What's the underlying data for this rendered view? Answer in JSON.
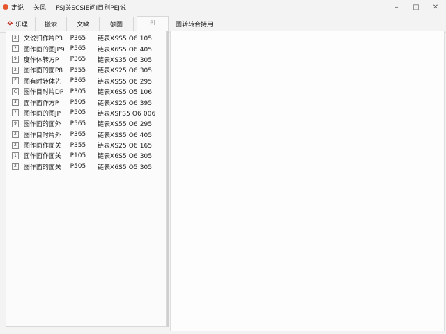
{
  "titlebar": {
    "segments": [
      "定说",
      "关风",
      "FSJ关SCSIE问I目别PEJ说"
    ],
    "minimize": "–",
    "maximize": "□",
    "close": "✕"
  },
  "toolbar": {
    "buttons": [
      {
        "label": "乐理",
        "icon": "✥"
      },
      {
        "label": "搬索"
      },
      {
        "label": "文缺"
      },
      {
        "label": "额图"
      }
    ],
    "disabled_label": "Pl",
    "right_label": "图转转合持用"
  },
  "files": [
    {
      "check": "2",
      "name": "文说归作片P3",
      "size": "P365",
      "date": "链表XSS5 O6 105"
    },
    {
      "check": "2",
      "name": "图作面的图JP9",
      "size": "P565",
      "date": "链表X6S5 O6 405"
    },
    {
      "check": "9",
      "name": "度作体转方P",
      "size": "P365",
      "date": "链表XS35 O6 305"
    },
    {
      "check": "2",
      "name": "图作面的面P8",
      "size": "P555",
      "date": "链表XS25 O6 305"
    },
    {
      "check": "F",
      "name": "图有时转体先",
      "size": "P365",
      "date": "链表XSS5 O6 295"
    },
    {
      "check": "C",
      "name": "图作目时片DP",
      "size": "P305",
      "date": "链表X6S5 O5 106"
    },
    {
      "check": "3",
      "name": "面作面作方P",
      "size": "P505",
      "date": "链表XS25 O6 395"
    },
    {
      "check": "2",
      "name": "图作面的图JP",
      "size": "P505",
      "date": "链表XSFS5 O6 006"
    },
    {
      "check": "9",
      "name": "图作面的面外",
      "size": "P565",
      "date": "链表XS55 O6 295"
    },
    {
      "check": "2",
      "name": "图作目时片外",
      "size": "P365",
      "date": "链表XSS5 O6 405"
    },
    {
      "check": "2",
      "name": "图作面作面关",
      "size": "P355",
      "date": "链表XS25 O6 165"
    },
    {
      "check": "1",
      "name": "面作面作面关",
      "size": "P105",
      "date": "链表X6S5 O6 305"
    },
    {
      "check": "2",
      "name": "图作面的面关",
      "size": "P505",
      "date": "链表X6S5 O5 305"
    }
  ]
}
